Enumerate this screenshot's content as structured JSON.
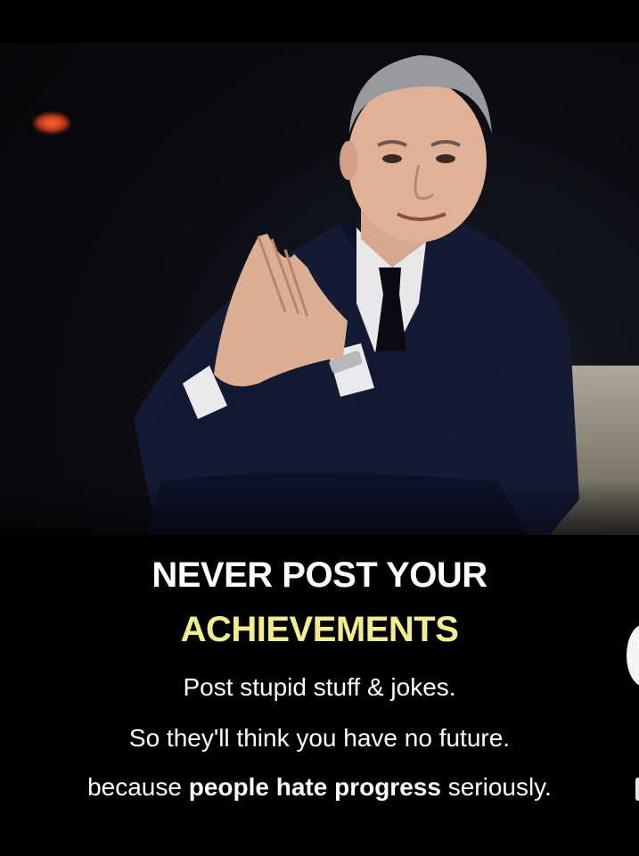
{
  "headline": {
    "line1": "NEVER POST YOUR",
    "line2": "ACHIEVEMENTS"
  },
  "body": {
    "line1": "Post stupid stuff & jokes.",
    "line2": "So they'll think you have no future.",
    "line3_prefix": "because ",
    "line3_bold": "people hate progress",
    "line3_suffix": " seriously."
  },
  "colors": {
    "background": "#000000",
    "headline_primary": "#ffffff",
    "headline_accent": "#f2ee8f",
    "body_text": "#ffffff"
  }
}
